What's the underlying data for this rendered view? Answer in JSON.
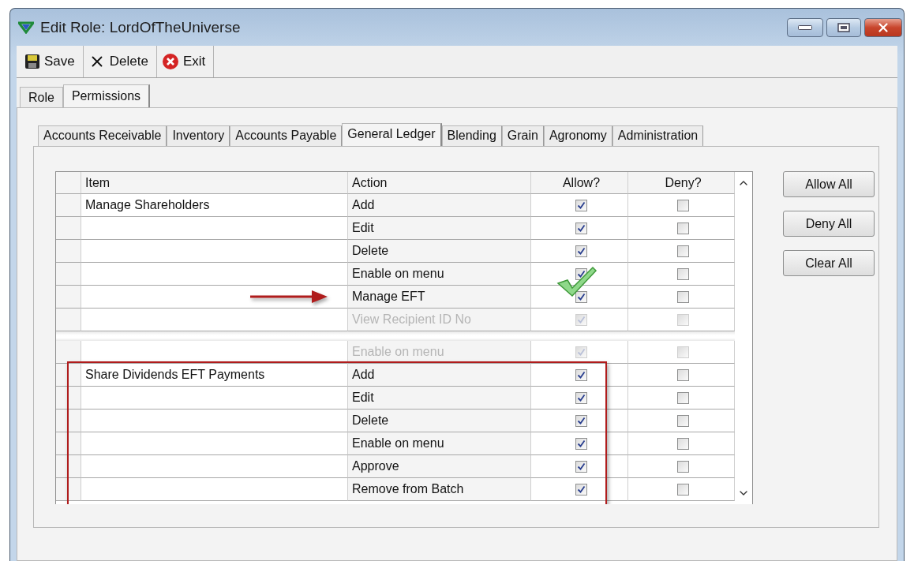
{
  "window": {
    "title": "Edit Role: LordOfTheUniverse"
  },
  "toolbar": [
    {
      "label": "Save",
      "kind": "save"
    },
    {
      "label": "Delete",
      "kind": "delete"
    },
    {
      "label": "Exit",
      "kind": "exit"
    }
  ],
  "tabs": [
    {
      "label": "Role",
      "selected": false
    },
    {
      "label": "Permissions",
      "selected": true
    }
  ],
  "module_tabs": [
    {
      "label": "Accounts Receivable",
      "selected": false
    },
    {
      "label": "Inventory",
      "selected": false
    },
    {
      "label": "Accounts Payable",
      "selected": false
    },
    {
      "label": "General Ledger",
      "selected": true
    },
    {
      "label": "Blending",
      "selected": false
    },
    {
      "label": "Grain",
      "selected": false
    },
    {
      "label": "Agronomy",
      "selected": false
    },
    {
      "label": "Administration",
      "selected": false
    }
  ],
  "table": {
    "columns": [
      "Item",
      "Action",
      "Allow?",
      "Deny?"
    ],
    "rows": [
      {
        "item": "Manage Shareholders",
        "action": "Add",
        "allow": true,
        "deny": false,
        "faded": false
      },
      {
        "action": "Edit",
        "allow": true,
        "deny": false,
        "faded": false
      },
      {
        "action": "Delete",
        "allow": true,
        "deny": false,
        "faded": false
      },
      {
        "action": "Enable on menu",
        "allow": true,
        "deny": false,
        "faded": false
      },
      {
        "action": "Manage EFT",
        "allow": true,
        "deny": false,
        "faded": false
      },
      {
        "action": "View Recipient ID No",
        "allow": true,
        "deny": false,
        "faded": true,
        "torn_after": true
      },
      {
        "action": "Enable on menu",
        "allow": true,
        "deny": false,
        "faded": true
      },
      {
        "item": "Share Dividends EFT Payments",
        "action": "Add",
        "allow": true,
        "deny": false,
        "faded": false
      },
      {
        "action": "Edit",
        "allow": true,
        "deny": false,
        "faded": false
      },
      {
        "action": "Delete",
        "allow": true,
        "deny": false,
        "faded": false
      },
      {
        "action": "Enable on menu",
        "allow": true,
        "deny": false,
        "faded": false
      },
      {
        "action": "Approve",
        "allow": true,
        "deny": false,
        "faded": false
      },
      {
        "action": "Remove from Batch",
        "allow": true,
        "deny": false,
        "faded": false
      }
    ]
  },
  "side_buttons": [
    "Allow All",
    "Deny All",
    "Clear All"
  ]
}
